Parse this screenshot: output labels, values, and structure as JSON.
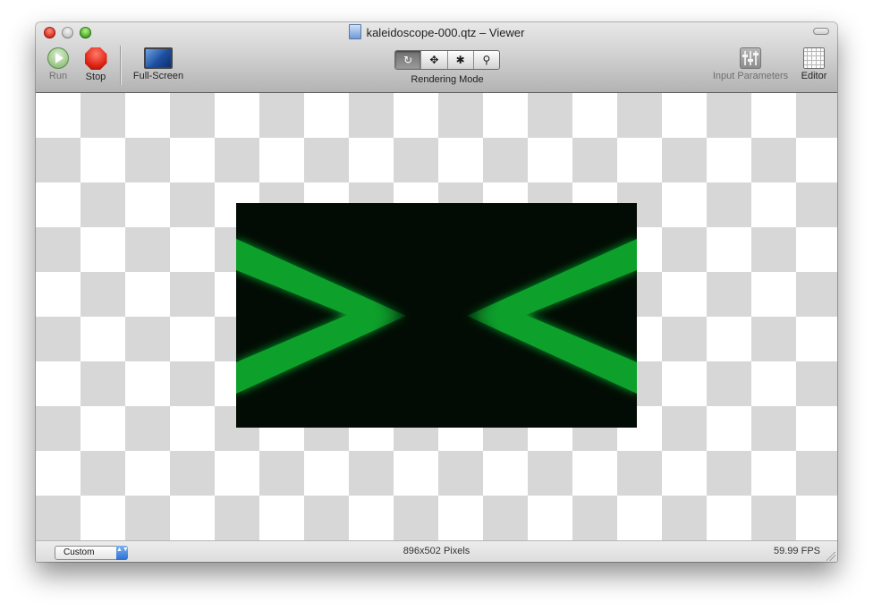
{
  "window": {
    "title": "kaleidoscope-000.qtz – Viewer"
  },
  "toolbar": {
    "run_label": "Run",
    "stop_label": "Stop",
    "fullscreen_label": "Full-Screen",
    "rendering_mode_label": "Rendering Mode",
    "rendering_modes": [
      {
        "icon": "rotate-icon",
        "glyph": "↻",
        "selected": true
      },
      {
        "icon": "move-icon",
        "glyph": "✥",
        "selected": false
      },
      {
        "icon": "bug-icon",
        "glyph": "✱",
        "selected": false
      },
      {
        "icon": "magnifier-icon",
        "glyph": "⚲",
        "selected": false
      }
    ],
    "input_parameters_label": "Input Parameters",
    "editor_label": "Editor"
  },
  "status": {
    "size_preset": "Custom",
    "select_arrows": "▲▼",
    "dimensions": "896x502 Pixels",
    "fps": "59.99 FPS"
  },
  "colors": {
    "render_background": "#020c04",
    "render_stroke": "#0ea02c",
    "checker_light": "#ffffff",
    "checker_dark": "#d7d7d7"
  }
}
